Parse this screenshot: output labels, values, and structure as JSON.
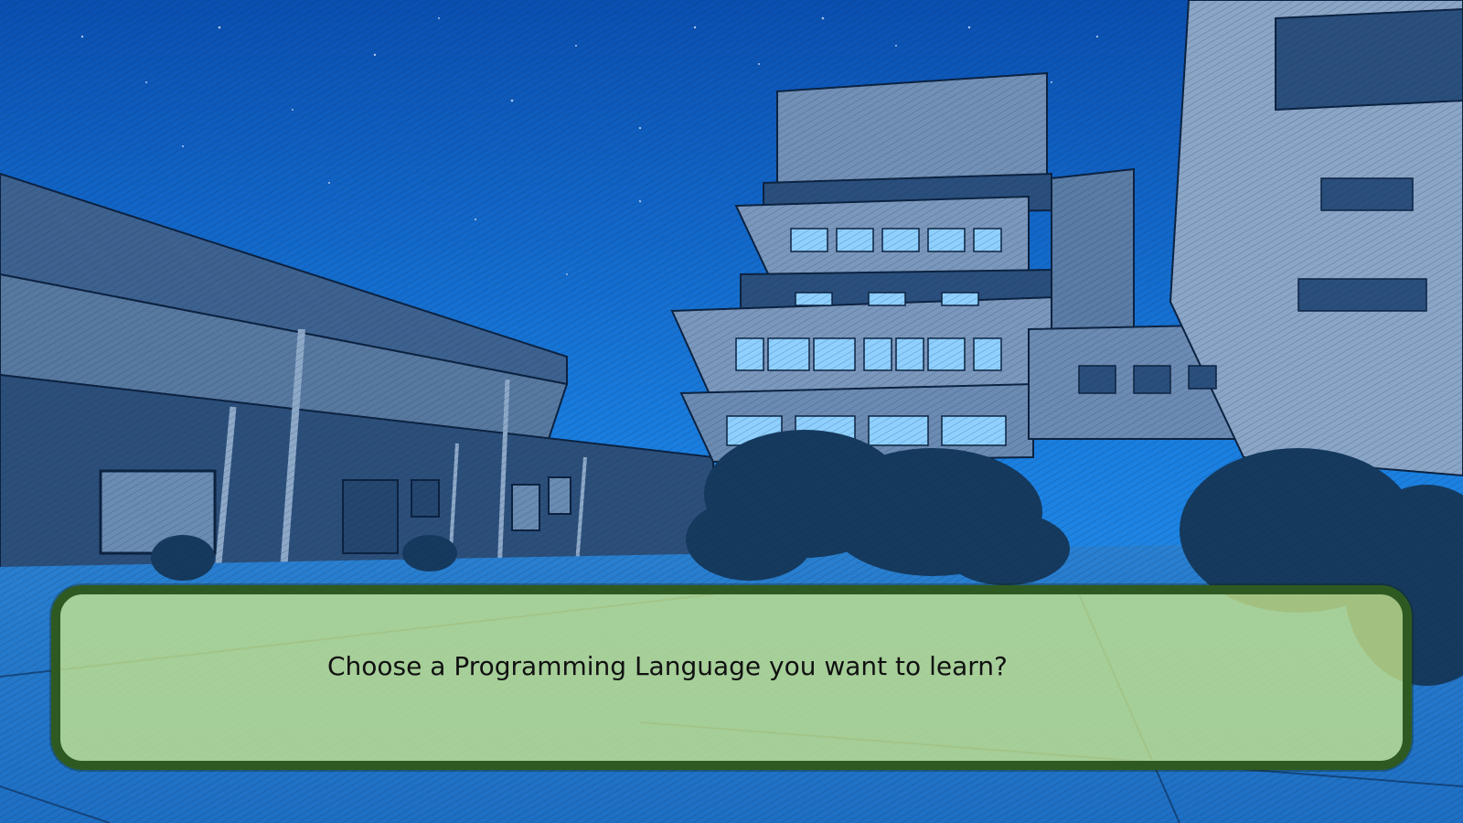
{
  "dialogue": {
    "text": "Choose a Programming Language you want to learn?"
  },
  "colors": {
    "sky_top": "#0a4fb0",
    "sky_bottom": "#1c8ee8",
    "building": "#6e90b8",
    "building_shadow": "#2a4f7c",
    "window_light": "#8fd0ff",
    "trees": "#153a5e",
    "ground": "#2f8ad8",
    "dialogue_border": "#2e5a22",
    "dialogue_fill": "#cae88c"
  }
}
